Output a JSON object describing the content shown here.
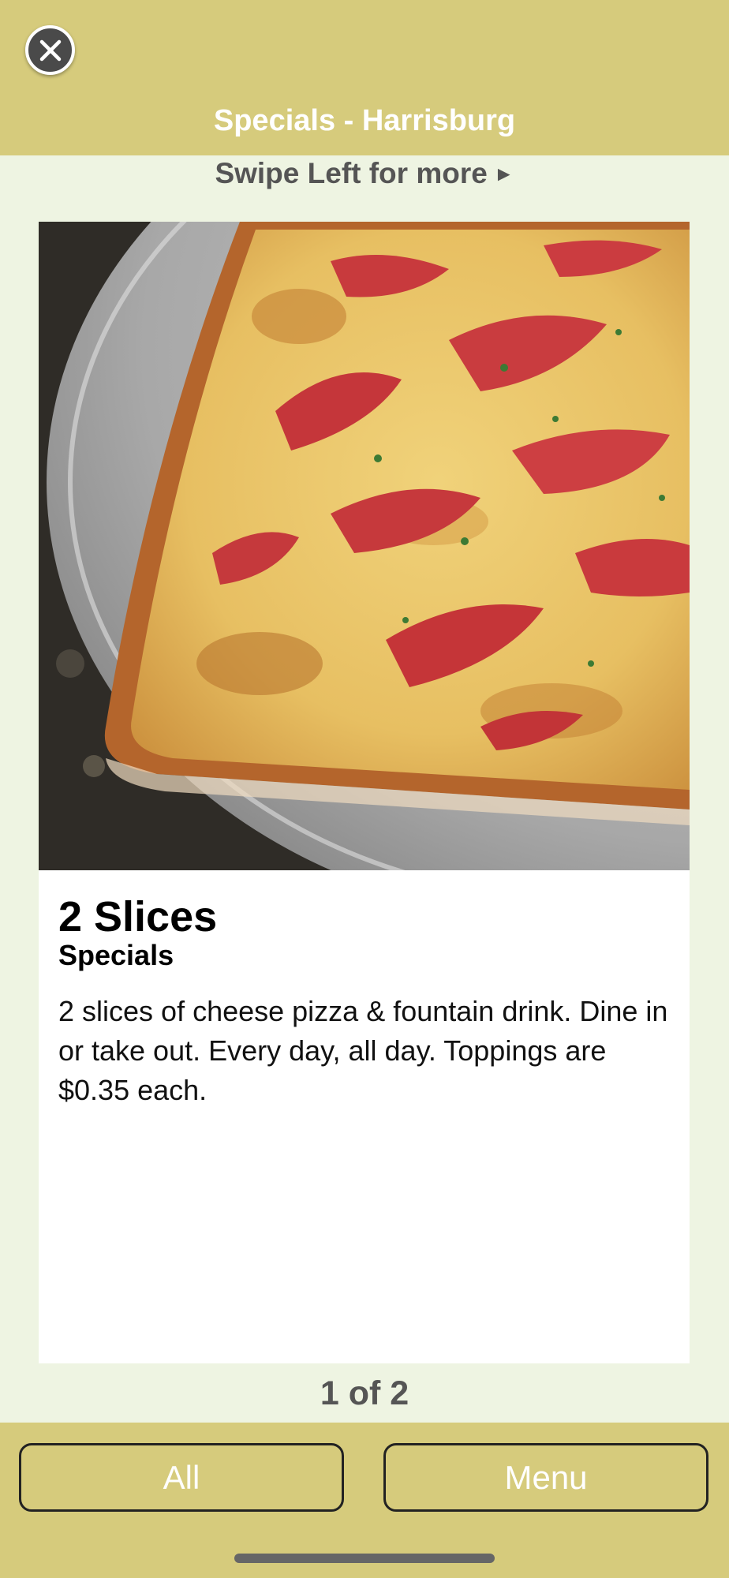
{
  "header": {
    "title": "Specials - Harrisburg",
    "close_icon": "close-circle-icon"
  },
  "swipe_hint": {
    "text": "Swipe Left for more",
    "arrow": "►"
  },
  "item": {
    "title": "2 Slices",
    "category": "Specials",
    "description": "2 slices of cheese pizza & fountain drink. Dine in or take out. Every day, all day. Toppings are $0.35 each.",
    "image": "pizza-photo"
  },
  "pager": {
    "text": "1 of 2"
  },
  "footer": {
    "all_label": "All",
    "menu_label": "Menu"
  },
  "colors": {
    "header_bg": "#d6cb7c",
    "page_bg": "#eef4e2",
    "card_bg": "#ffffff"
  }
}
